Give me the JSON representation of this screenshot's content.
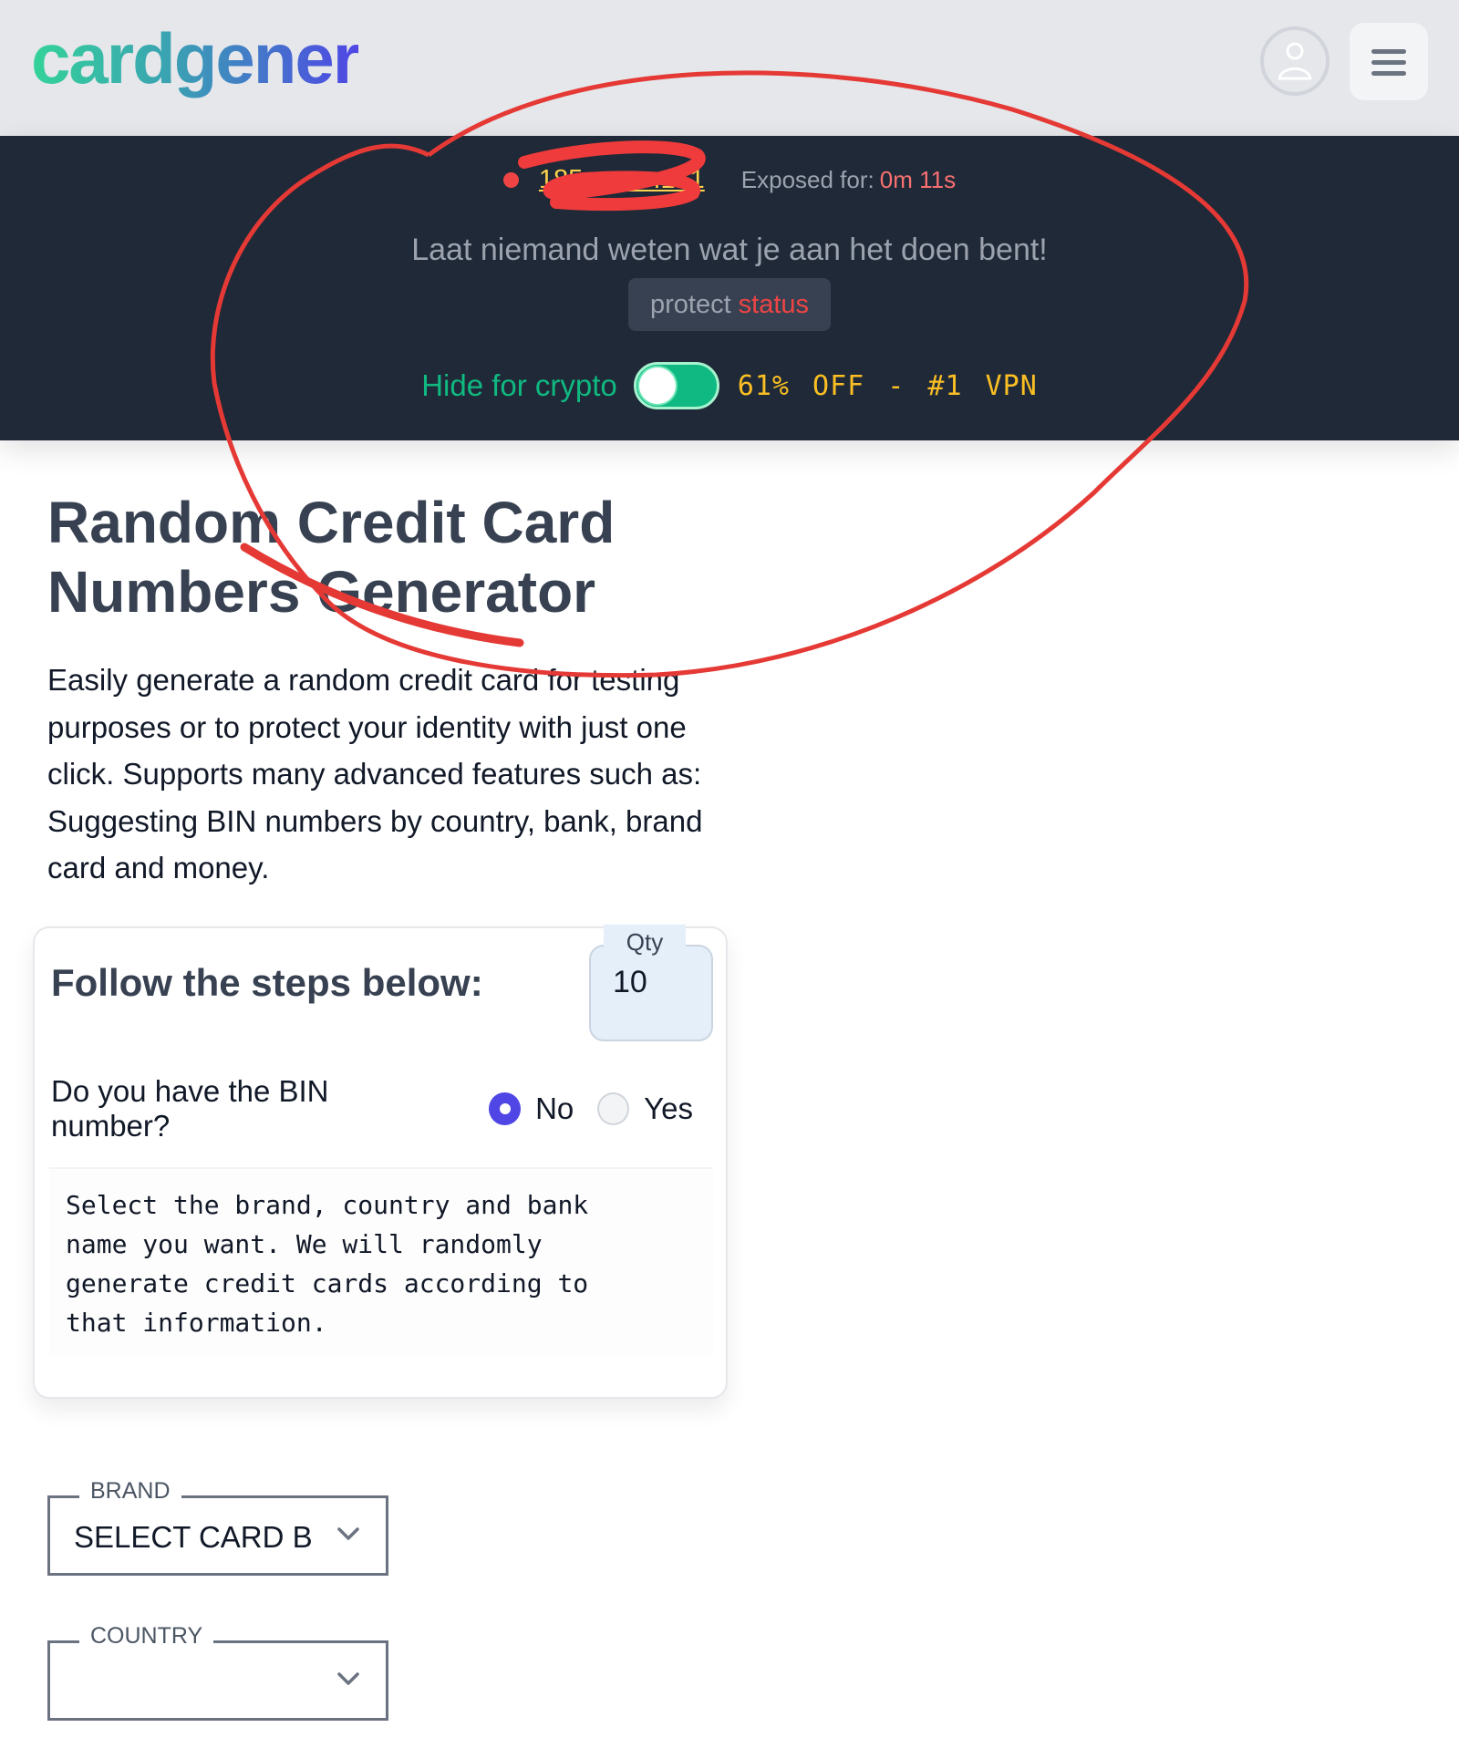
{
  "header": {
    "logo": "cardgener",
    "user_icon": "user-icon",
    "menu_icon": "hamburger-menu-icon"
  },
  "banner": {
    "ip_address": "185.•••.•••.161",
    "exposed_label": "Exposed for:",
    "exposed_time": "0m 11s",
    "warning": "Laat niemand weten wat je aan het doen bent!",
    "protect_label": "protect",
    "protect_status": "status",
    "crypto_label": "Hide for crypto",
    "crypto_toggle_on": true,
    "vpn_offer": "61% OFF - #1 VPN"
  },
  "main": {
    "title": "Random Credit Card Numbers Generator",
    "intro": "Easily generate a random credit card for testing purposes or to protect your identity with just one click. Supports many advanced features such as: Suggesting BIN numbers by country, bank, brand card and money."
  },
  "steps_card": {
    "title": "Follow the steps below:",
    "qty_label": "Qty",
    "qty_value": "10",
    "bin_question": "Do you have the BIN number?",
    "bin_options": [
      {
        "label": "No",
        "checked": true
      },
      {
        "label": "Yes",
        "checked": false
      }
    ],
    "info_text": "Select the brand, country and bank\nname you want. We will randomly\ngenerate credit cards according to\nthat information."
  },
  "fields": {
    "brand": {
      "label": "BRAND",
      "value": "SELECT CARD BRAND"
    },
    "country": {
      "label": "COUNTRY",
      "value": ""
    }
  },
  "colors": {
    "banner_bg": "#1f2937",
    "accent_green": "#10b981",
    "accent_yellow": "#fbbf24",
    "alert_red": "#ef4444",
    "radio_selected": "#4f46e5"
  }
}
